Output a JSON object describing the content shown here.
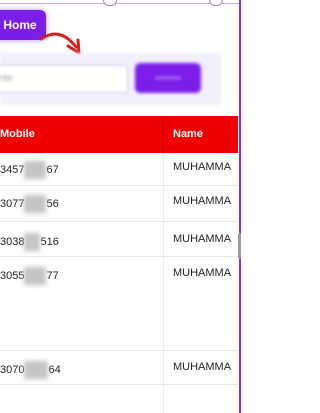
{
  "toolbar": {
    "home_label": "Home"
  },
  "search": {
    "placeholder_visible": "nte",
    "button_label": ""
  },
  "table": {
    "headers": [
      "Mobile",
      "Name"
    ],
    "rows": [
      {
        "mobile_start": "3457",
        "mobile_end": "67",
        "name": "MUHAMMA"
      },
      {
        "mobile_start": "3077",
        "mobile_end": "56",
        "name": "MUHAMMA"
      },
      {
        "mobile_start": "3038",
        "mobile_end": "516",
        "name": "MUHAMMA"
      },
      {
        "mobile_start": "3055",
        "mobile_end": "77",
        "name": "MUHAMMA"
      },
      {
        "mobile_start": "3070",
        "mobile_end": "64",
        "name": "MUHAMMA"
      }
    ]
  },
  "colors": {
    "accent": "#7b1fe8",
    "header_bg": "#ee0000",
    "annotation_arrow": "#d61f1f"
  },
  "icons": {
    "annotation": "curved-arrow-icon"
  }
}
